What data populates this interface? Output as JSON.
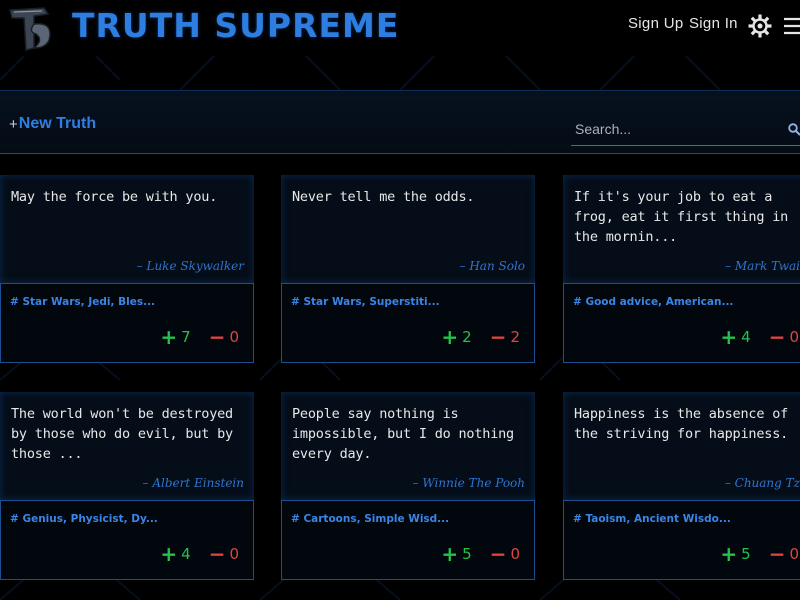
{
  "header": {
    "brand": "TRUTH SUPREME",
    "sign_up": "Sign Up",
    "sign_in": "Sign In"
  },
  "toolbar": {
    "new_truth_plus": "+",
    "new_truth_label": "New Truth",
    "search_placeholder": "Search..."
  },
  "cards": [
    {
      "quote": "May the force be with you.",
      "author": "– Luke Skywalker",
      "tags": "# Star Wars, Jedi, Bles...",
      "up": "7",
      "down": "0"
    },
    {
      "quote": "Never tell me the odds.",
      "author": "– Han Solo",
      "tags": "# Star Wars, Superstiti...",
      "up": "2",
      "down": "2"
    },
    {
      "quote": "If it's your job to eat a frog, eat it first thing in the mornin...",
      "author": "– Mark Twai",
      "tags": "# Good advice, American...",
      "up": "4",
      "down": "0"
    },
    {
      "quote": "The world won't be destroyed by those who do evil, but by those ...",
      "author": "– Albert Einstein",
      "tags": "# Genius, Physicist, Dy...",
      "up": "4",
      "down": "0"
    },
    {
      "quote": "People say nothing is impossible, but I do nothing every day.",
      "author": "– Winnie The Pooh",
      "tags": "# Cartoons, Simple Wisd...",
      "up": "5",
      "down": "0"
    },
    {
      "quote": "Happiness is the absence of the striving for happiness.",
      "author": "– Chuang Tz",
      "tags": "# Taoism, Ancient Wisdo...",
      "up": "5",
      "down": "0"
    }
  ],
  "colors": {
    "accent": "#2f7fe3",
    "upvote": "#23c24a",
    "downvote": "#e0453d",
    "background": "#000000"
  }
}
